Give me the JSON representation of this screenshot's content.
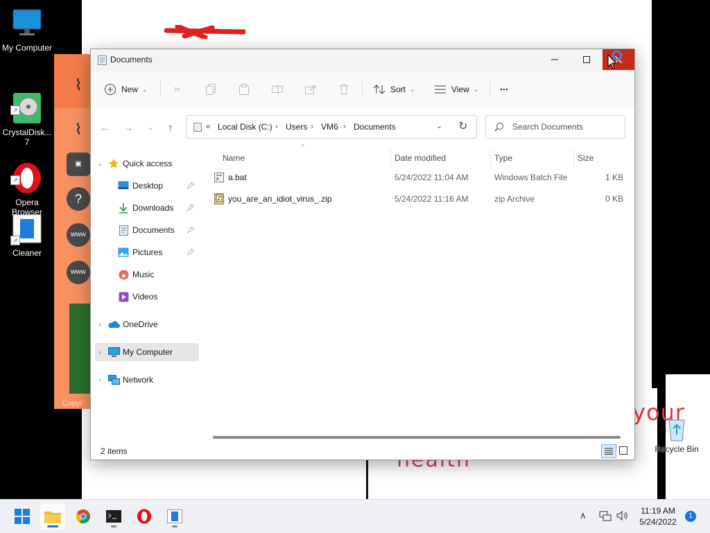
{
  "desktop": {
    "icons": [
      {
        "label": "My Computer"
      },
      {
        "label": "CrystalDisk...\n7"
      },
      {
        "label": "Opera\nBrowser"
      },
      {
        "label": "Cleaner"
      }
    ],
    "recycle_bin_label": "Recycle Bin",
    "wallpaper_text_1": "health",
    "wallpaper_text_2": "your",
    "background_app_footer": "Copyr"
  },
  "window": {
    "title": "Documents",
    "toolbar": {
      "new_label": "New",
      "sort_label": "Sort",
      "view_label": "View",
      "more_label": "..."
    },
    "address": {
      "breadcrumbs": [
        "Local Disk (C:)",
        "Users",
        "VM6",
        "Documents"
      ]
    },
    "search": {
      "placeholder": "Search Documents"
    },
    "nav": {
      "quick_access": "Quick access",
      "items": [
        {
          "label": "Desktop",
          "icon": "desktop-icon",
          "pinned": true
        },
        {
          "label": "Downloads",
          "icon": "download-icon",
          "pinned": true
        },
        {
          "label": "Documents",
          "icon": "document-icon",
          "pinned": true
        },
        {
          "label": "Pictures",
          "icon": "picture-icon",
          "pinned": true
        },
        {
          "label": "Music",
          "icon": "music-icon",
          "pinned": false
        },
        {
          "label": "Videos",
          "icon": "video-icon",
          "pinned": false
        }
      ],
      "onedrive": "OneDrive",
      "my_computer": "My Computer",
      "network": "Network"
    },
    "columns": {
      "name": "Name",
      "date": "Date modified",
      "type": "Type",
      "size": "Size"
    },
    "files": [
      {
        "name": "a.bat",
        "date": "5/24/2022 11:04 AM",
        "type": "Windows Batch File",
        "size": "1 KB"
      },
      {
        "name": "you_are_an_idiot_virus_.zip",
        "date": "5/24/2022 11:16 AM",
        "type": "zip Archive",
        "size": "0 KB"
      }
    ],
    "status": "2 items"
  },
  "taskbar": {
    "time": "11:19 AM",
    "date": "5/24/2022",
    "notifications": "1"
  },
  "colors": {
    "close_button": "#c42b1c",
    "accent": "#2b6fd6",
    "orange_app": "#f7915f"
  }
}
